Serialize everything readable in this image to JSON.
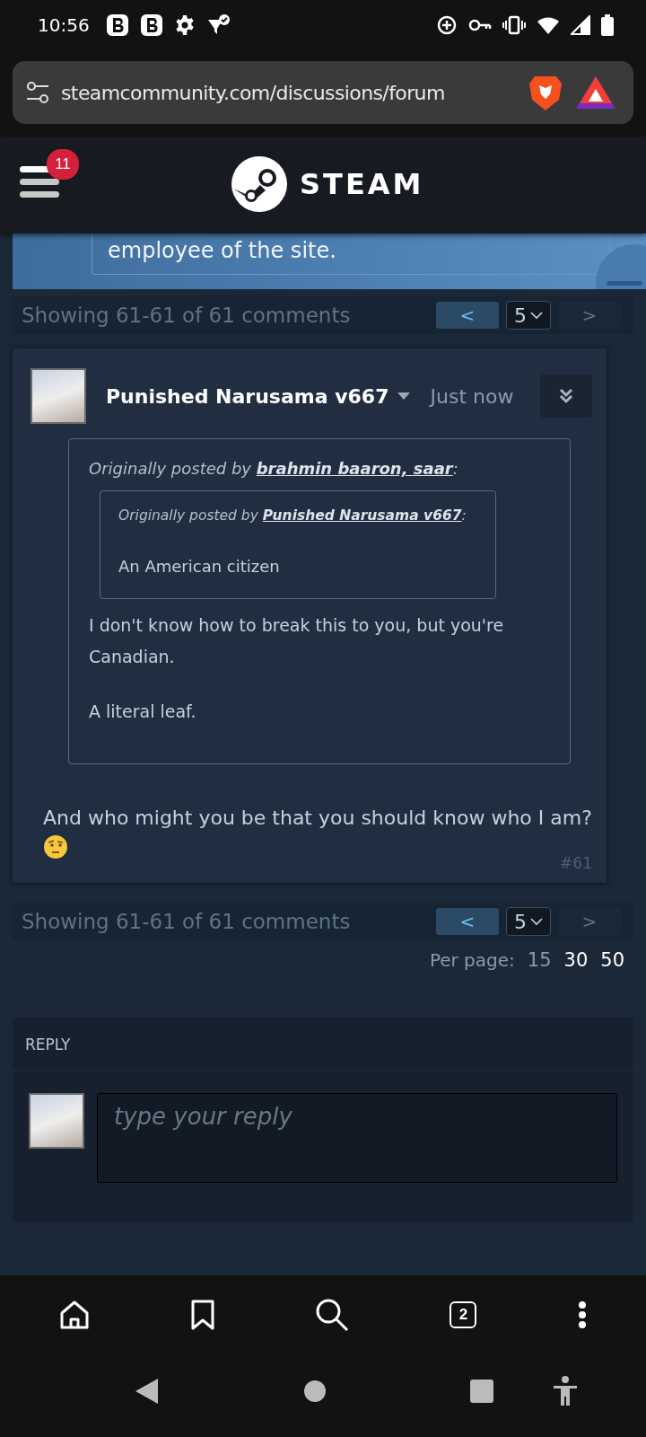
{
  "status_bar": {
    "time": "10:56"
  },
  "browser": {
    "url": "steamcommunity.com/discussions/forum",
    "tab_count": "2"
  },
  "header": {
    "notification_count": "11",
    "logo_text": "STEAM"
  },
  "previous_post": {
    "quote_text": "employee of the site."
  },
  "pagination_top": {
    "summary": "Showing 61-61 of 61 comments",
    "prev_label": "<",
    "page": "5",
    "next_label": ">",
    "prev_disabled": false,
    "next_disabled": true
  },
  "post": {
    "author": "Punished Narusama v667",
    "time": "Just now",
    "quote": {
      "attribution": "Originally posted by",
      "author": "brahmin baaron, saar",
      "separator": ":",
      "nested_quote": {
        "attribution": "Originally posted by",
        "author": "Punished Narusama v667",
        "separator": ":",
        "text": "An American citizen"
      },
      "paragraphs": [
        "I don't know how to break this to you, but you're Canadian.",
        "A literal leaf."
      ]
    },
    "text": "And who might you be that you should know who I am?",
    "number": "#61"
  },
  "pagination_bottom": {
    "summary": "Showing 61-61 of 61 comments",
    "prev_label": "<",
    "page": "5",
    "next_label": ">",
    "prev_disabled": false,
    "next_disabled": true,
    "per_page_label": "Per page:",
    "per_page": [
      {
        "label": "15",
        "selected": true
      },
      {
        "label": "30",
        "selected": false
      },
      {
        "label": "50",
        "selected": false
      }
    ]
  },
  "reply": {
    "title": "REPLY",
    "placeholder": "type your reply"
  }
}
